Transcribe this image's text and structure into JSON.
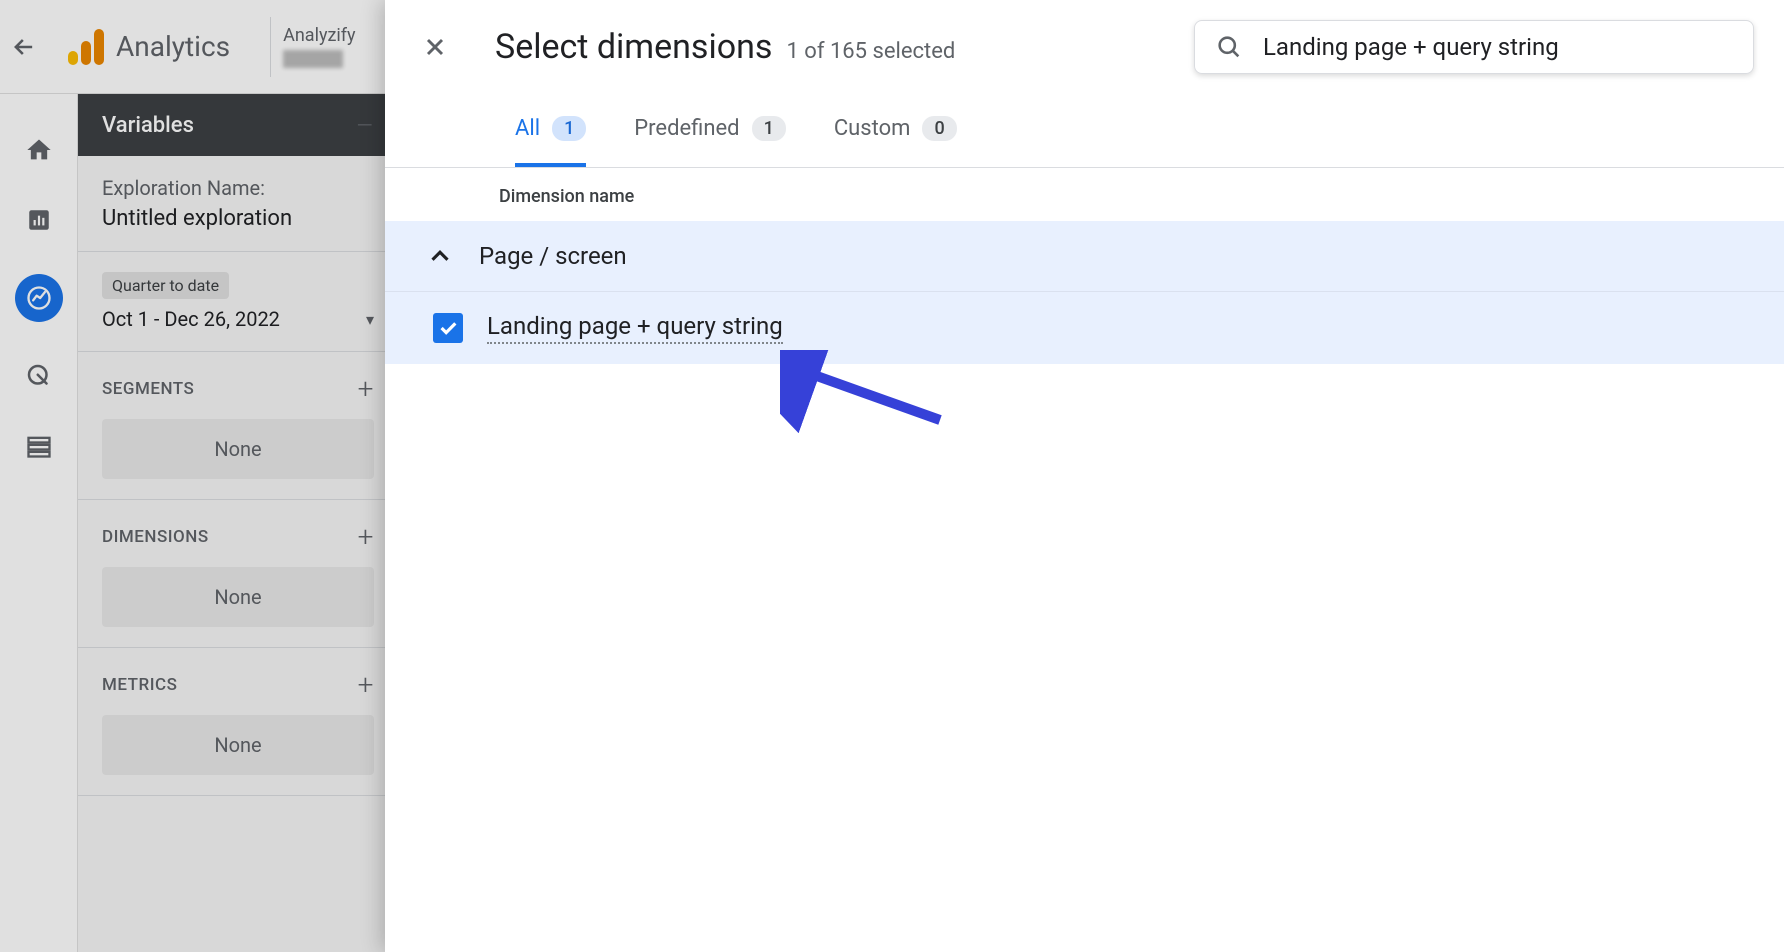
{
  "header": {
    "product": "Analytics",
    "account": "Analyzify"
  },
  "sidebar": {
    "title": "Variables",
    "exploration_label": "Exploration Name:",
    "exploration_value": "Untitled exploration",
    "date_chip": "Quarter to date",
    "date_range": "Oct 1 - Dec 26, 2022",
    "sections": [
      {
        "label": "SEGMENTS",
        "value": "None"
      },
      {
        "label": "DIMENSIONS",
        "value": "None"
      },
      {
        "label": "METRICS",
        "value": "None"
      }
    ]
  },
  "modal": {
    "title": "Select dimensions",
    "subtitle": "1 of 165 selected",
    "search_value": "Landing page + query string",
    "tabs": [
      {
        "label": "All",
        "count": "1",
        "active": true
      },
      {
        "label": "Predefined",
        "count": "1",
        "active": false
      },
      {
        "label": "Custom",
        "count": "0",
        "active": false
      }
    ],
    "column_header": "Dimension name",
    "group": "Page / screen",
    "item": "Landing page + query string"
  }
}
